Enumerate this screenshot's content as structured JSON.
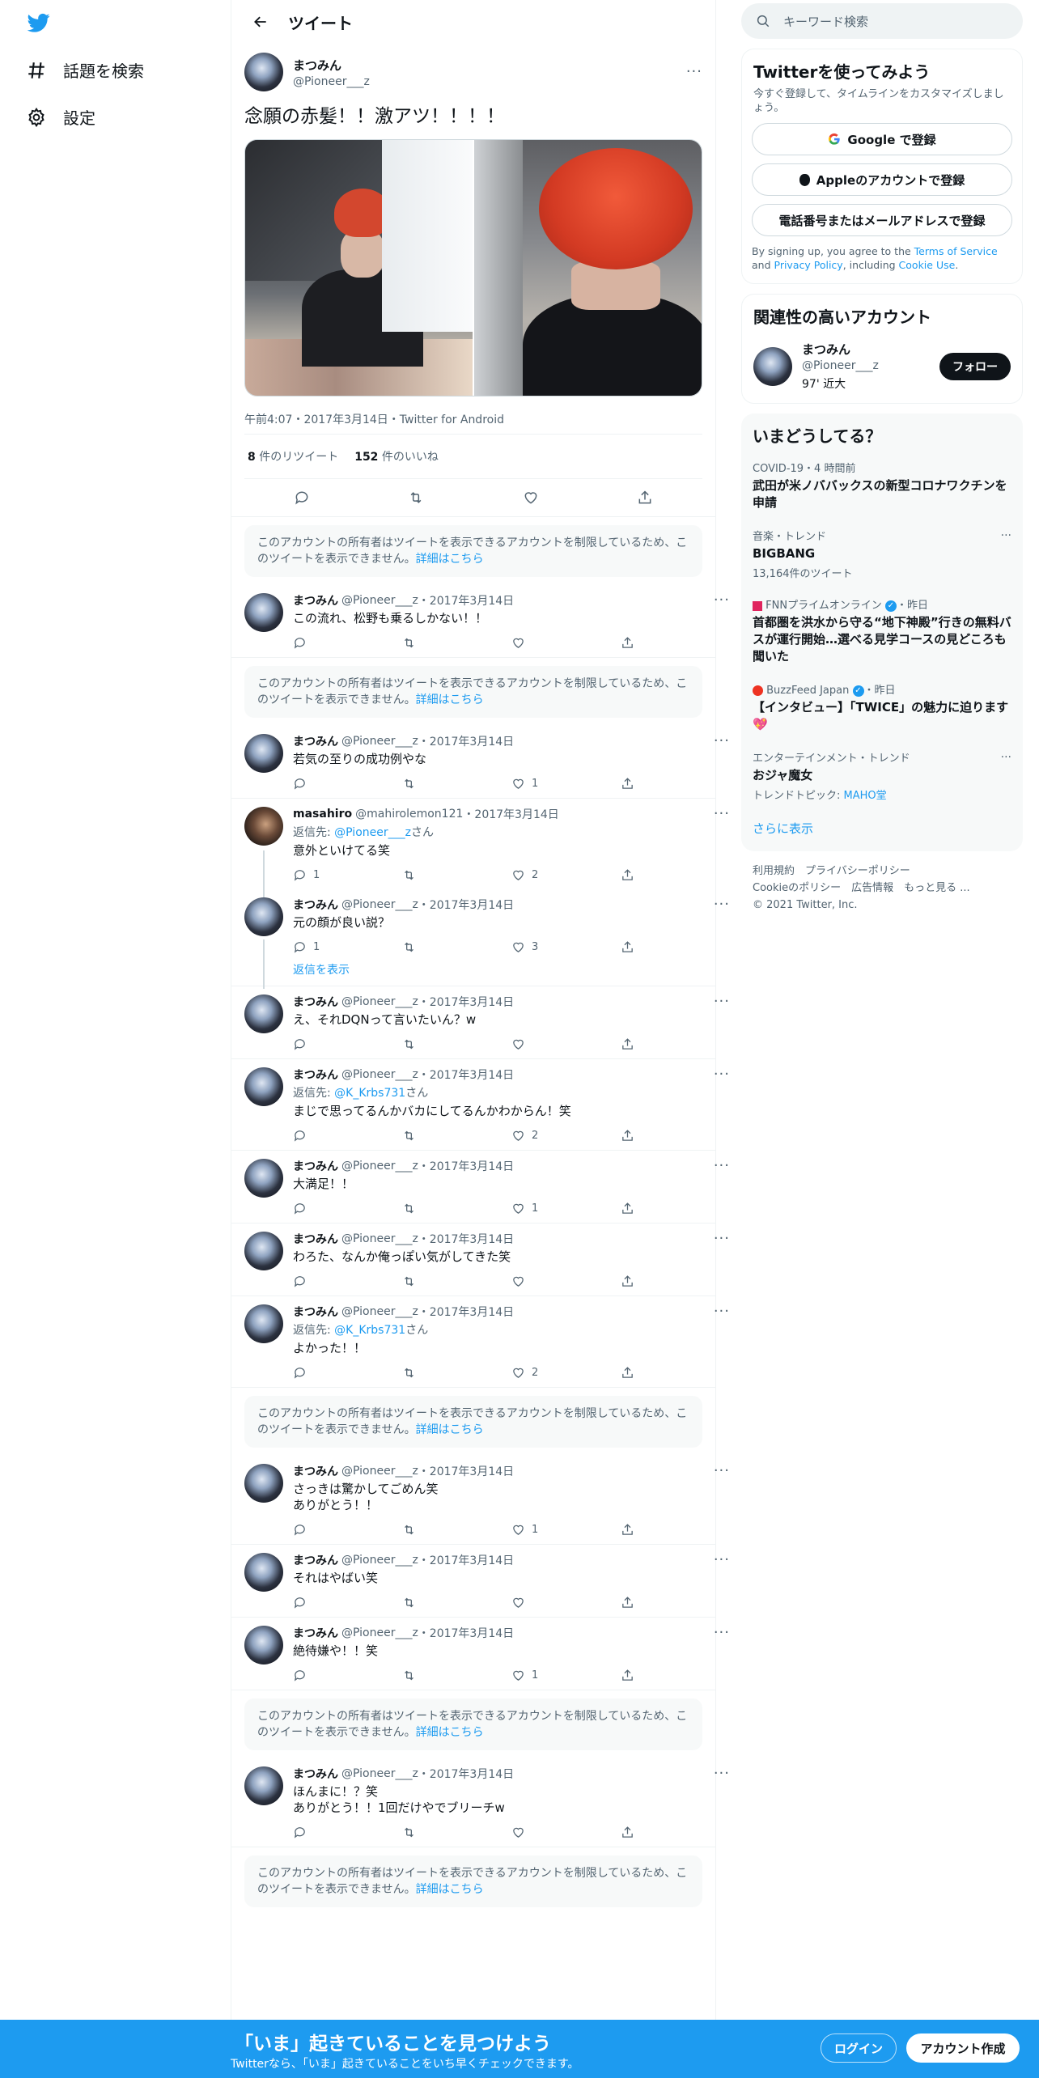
{
  "nav": {
    "items": [
      {
        "label": "話題を検索"
      },
      {
        "label": "設定"
      }
    ]
  },
  "header": {
    "title": "ツイート"
  },
  "main_tweet": {
    "name": "まつみん",
    "handle": "@Pioneer___z",
    "text": "念願の赤髪！！激アツ！！！！",
    "meta": "午前4:07・2017年3月14日・Twitter for Android",
    "retweets_count": "8",
    "retweets_label": " 件のリツイート",
    "likes_count": "152",
    "likes_label": " 件のいいね"
  },
  "restricted": {
    "text": "このアカウントの所有者はツイートを表示できるアカウントを制限しているため、このツイートを表示できません。",
    "link": "詳細はこちら"
  },
  "replies": [
    {
      "name": "まつみん",
      "handle": "@Pioneer___z",
      "date": "2017年3月14日",
      "text": "この流れ、松野も乗るしかない！！",
      "likes": ""
    },
    {
      "name": "まつみん",
      "handle": "@Pioneer___z",
      "date": "2017年3月14日",
      "text": "若気の至りの成功例やな",
      "likes": "1"
    },
    {
      "name": "masahiro",
      "handle": "@mahirolemon121",
      "date": "2017年3月14日",
      "reply_prefix": "返信先: ",
      "reply_to": "@Pioneer___z",
      "reply_suffix": "さん",
      "text": "意外といけてる笑",
      "replies": "1",
      "likes": "2"
    },
    {
      "name": "まつみん",
      "handle": "@Pioneer___z",
      "date": "2017年3月14日",
      "text": "元の顔が良い説？",
      "replies": "1",
      "likes": "3"
    },
    {
      "name": "まつみん",
      "handle": "@Pioneer___z",
      "date": "2017年3月14日",
      "text": "え、それDQNって言いたいん？w",
      "likes": ""
    },
    {
      "name": "まつみん",
      "handle": "@Pioneer___z",
      "date": "2017年3月14日",
      "reply_prefix": "返信先: ",
      "reply_to": "@K_Krbs731",
      "reply_suffix": "さん",
      "text": "まじで思ってるんかバカにしてるんかわからん！笑",
      "likes": "2"
    },
    {
      "name": "まつみん",
      "handle": "@Pioneer___z",
      "date": "2017年3月14日",
      "text": "大満足！！",
      "likes": "1"
    },
    {
      "name": "まつみん",
      "handle": "@Pioneer___z",
      "date": "2017年3月14日",
      "text": "わろた、なんか俺っぽい気がしてきた笑",
      "likes": ""
    },
    {
      "name": "まつみん",
      "handle": "@Pioneer___z",
      "date": "2017年3月14日",
      "reply_prefix": "返信先: ",
      "reply_to": "@K_Krbs731",
      "reply_suffix": "さん",
      "text": "よかった！！",
      "likes": "2"
    },
    {
      "name": "まつみん",
      "handle": "@Pioneer___z",
      "date": "2017年3月14日",
      "text": "さっきは驚かしてごめん笑\nありがとう！！",
      "likes": "1"
    },
    {
      "name": "まつみん",
      "handle": "@Pioneer___z",
      "date": "2017年3月14日",
      "text": "それはやばい笑",
      "likes": ""
    },
    {
      "name": "まつみん",
      "handle": "@Pioneer___z",
      "date": "2017年3月14日",
      "text": "絶待嫌や！！笑",
      "likes": "1"
    },
    {
      "name": "まつみん",
      "handle": "@Pioneer___z",
      "date": "2017年3月14日",
      "text": "ほんまに！？笑\nありがとう！！1回だけやでブリーチw",
      "likes": ""
    }
  ],
  "show_replies": "返信を表示",
  "search": {
    "placeholder": "キーワード検索"
  },
  "signup_card": {
    "title": "Twitterを使ってみよう",
    "subtitle": "今すぐ登録して、タイムラインをカスタマイズしましょう。",
    "google": "Google で登録",
    "apple": "Appleのアカウントで登録",
    "phone": "電話番号またはメールアドレスで登録",
    "terms_pre": "By signing up, you agree to the ",
    "terms_tos": "Terms of Service",
    "terms_and": " and ",
    "terms_pp": "Privacy Policy",
    "terms_inc": ", including ",
    "terms_cookie": "Cookie Use",
    "terms_end": "."
  },
  "related": {
    "title": "関連性の高いアカウント",
    "name": "まつみん",
    "handle": "@Pioneer___z",
    "bio": "97' 近大",
    "follow": "フォロー"
  },
  "trends": {
    "title": "いまどうしてる？",
    "items": [
      {
        "ctx": "COVID-19・4 時間前",
        "title": "武田が米ノババックスの新型コロナワクチンを申請",
        "sub": ""
      },
      {
        "ctx": "音楽・トレンド",
        "title": "BIGBANG",
        "sub": "13,164件のツイート"
      },
      {
        "ctx": "FNNプライムオンライン",
        "ctx_time": "・昨日",
        "title": "首都圏を洪水から守る“地下神殿”行きの無料バスが運行開始…選べる見学コースの見どころも聞いた",
        "sub": ""
      },
      {
        "ctx": "BuzzFeed Japan",
        "ctx_time": "・昨日",
        "title": "【インタビュー】「TWICE」の魅力に迫ります💖",
        "sub": ""
      },
      {
        "ctx": "エンターテインメント・トレンド",
        "title": "おジャ魔女",
        "sub_prefix": "トレンドトピック: ",
        "sub_link": "MAHO堂"
      }
    ],
    "show_more": "さらに表示"
  },
  "footer": {
    "l1": "利用規約　プライバシーポリシー",
    "l2": "Cookieのポリシー　広告情報　もっと見る ...",
    "l3": "© 2021 Twitter, Inc."
  },
  "bottom_bar": {
    "title": "「いま」起きていることを見つけよう",
    "subtitle": "Twitterなら、「いま」起きていることをいち早くチェックできます。",
    "login": "ログイン",
    "signup": "アカウント作成"
  },
  "colors": {
    "accent": "#1d9bf0",
    "text": "#0f1419",
    "muted": "#536471"
  }
}
